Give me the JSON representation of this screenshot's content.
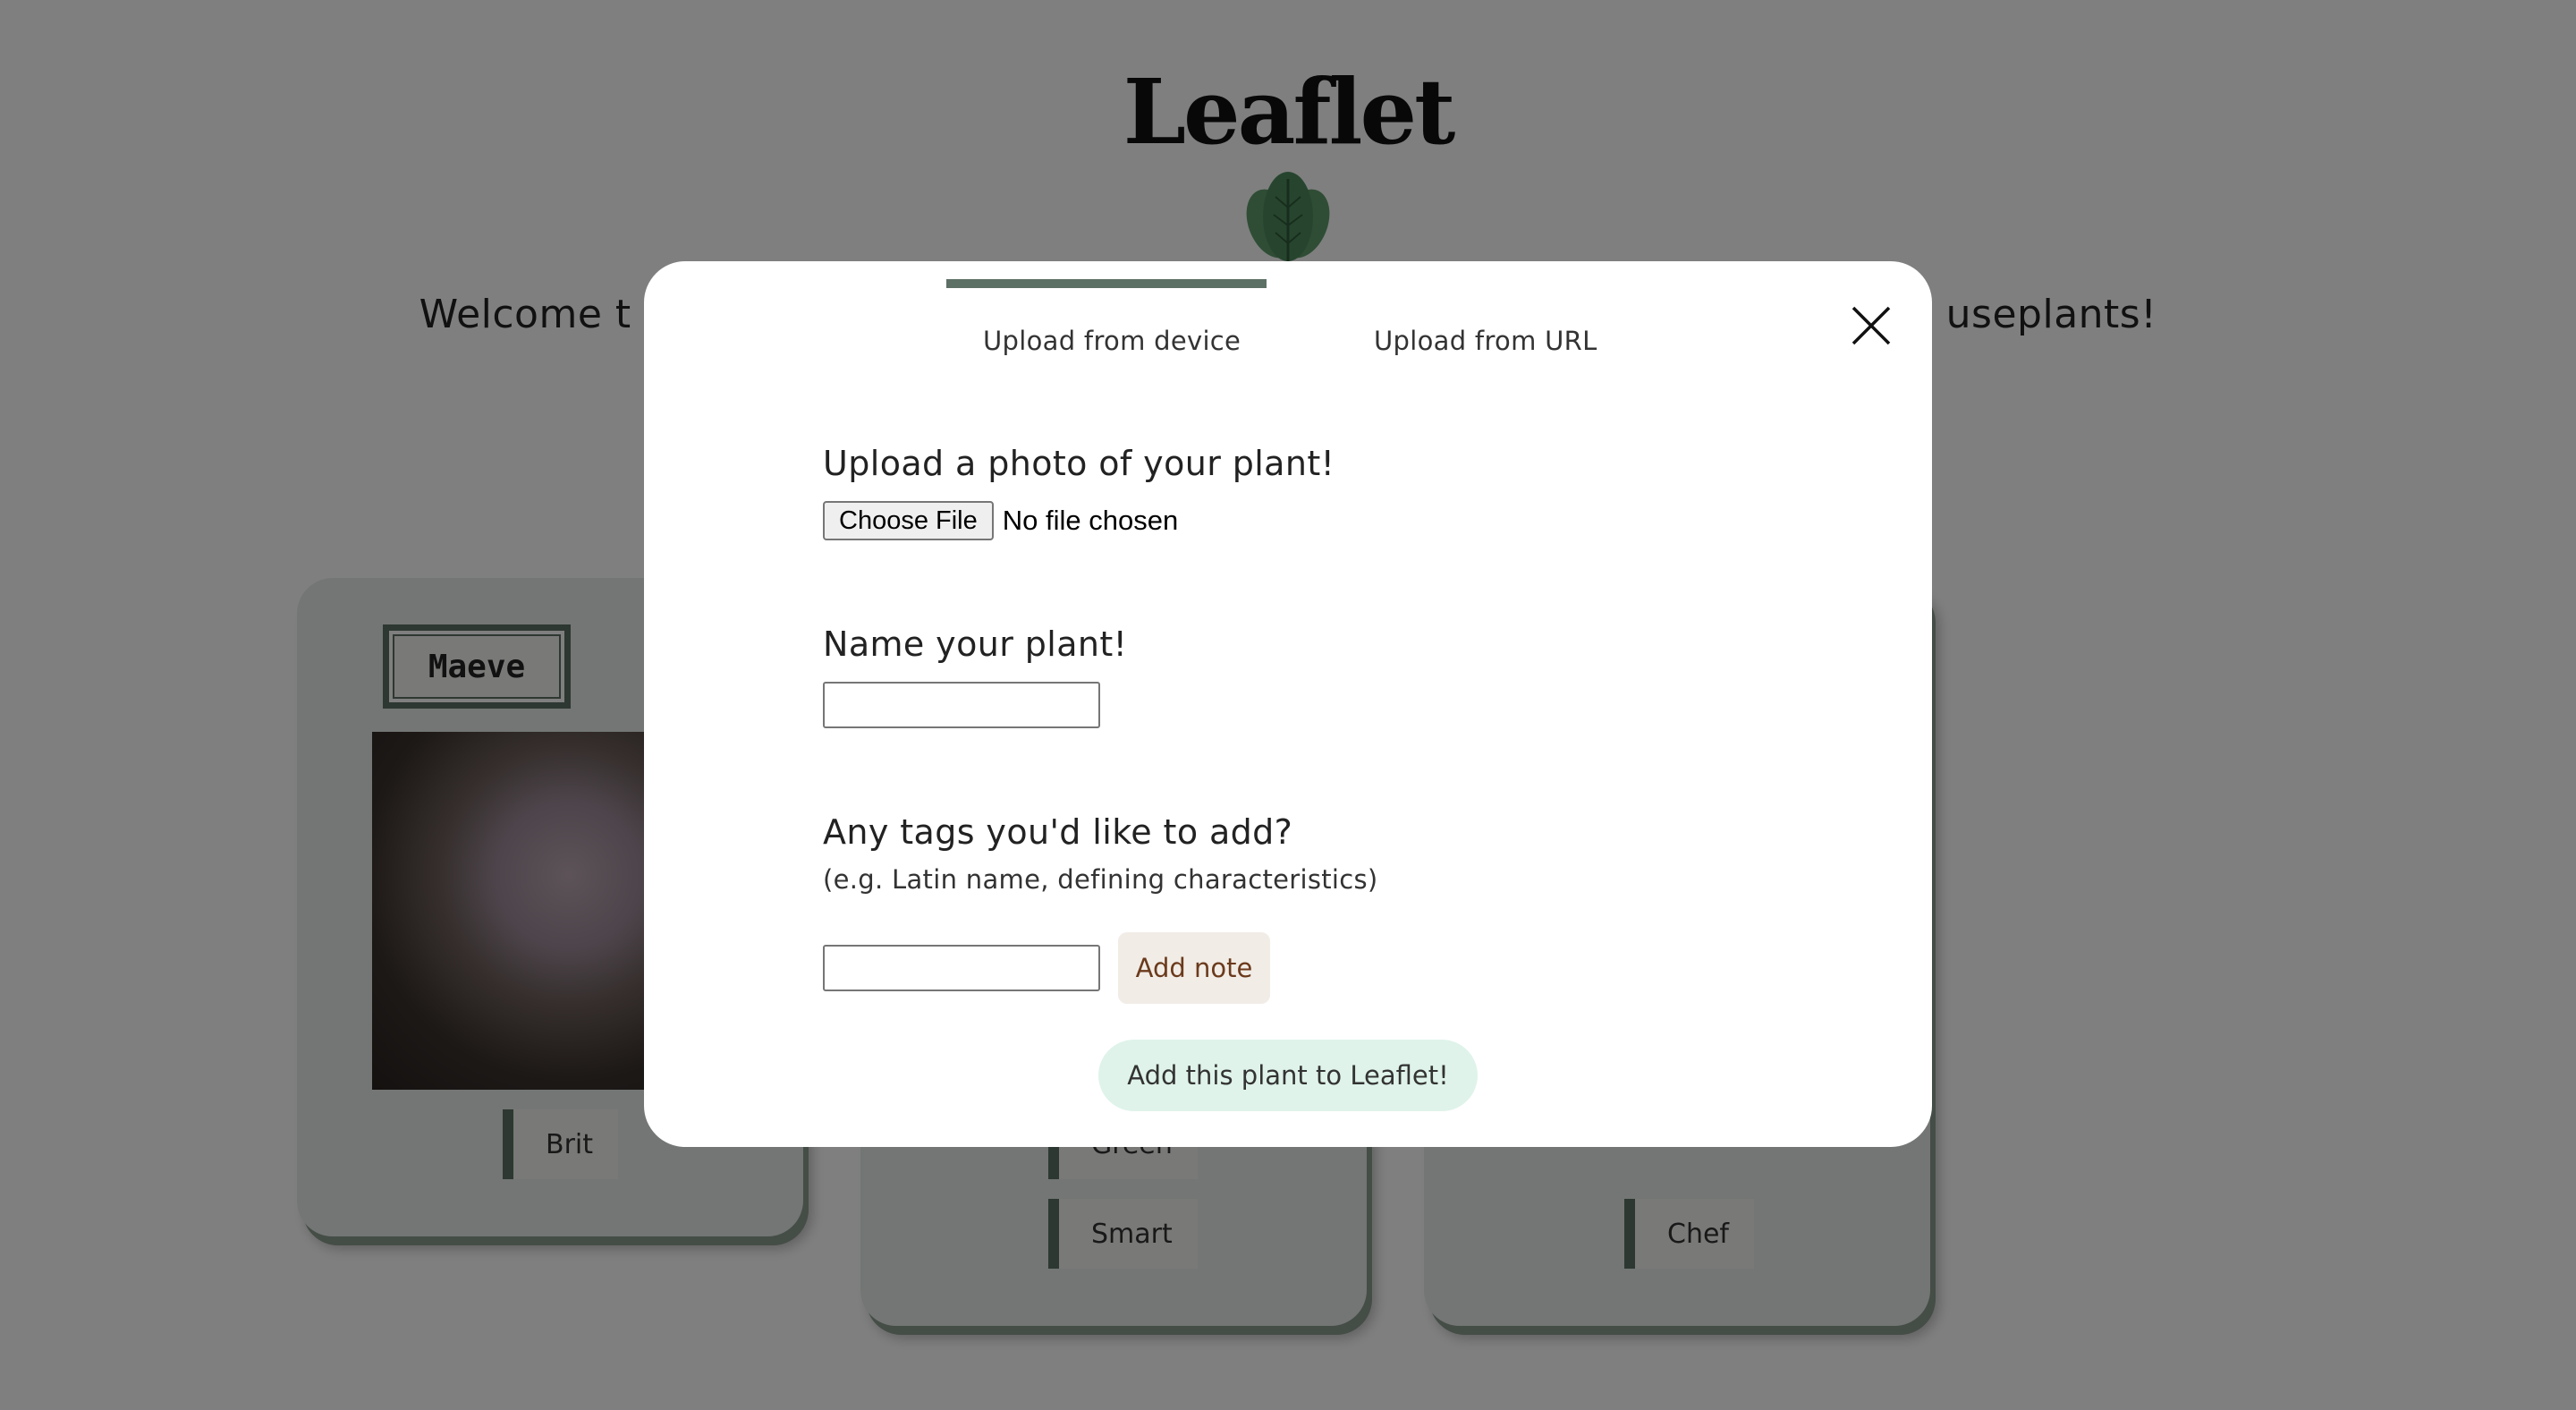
{
  "page": {
    "brand": "Leaflet",
    "welcome_left": "Welcome t",
    "welcome_right": "useplants!"
  },
  "cards": [
    {
      "name": "Maeve",
      "tags": [
        "Brit"
      ]
    },
    {
      "tags": [
        "Green",
        "Smart"
      ]
    },
    {
      "tags": [
        "Chef"
      ]
    }
  ],
  "modal": {
    "tabs": [
      {
        "label": "Upload from device",
        "active": true
      },
      {
        "label": "Upload from URL",
        "active": false
      }
    ],
    "photo_label": "Upload a photo of your plant!",
    "choose_file_label": "Choose File",
    "file_status": "No file chosen",
    "name_label": "Name your plant!",
    "name_value": "",
    "tags_label": "Any tags you'd like to add?",
    "tags_hint": "(e.g. Latin name, defining characteristics)",
    "tag_value": "",
    "add_note_label": "Add note",
    "submit_label": "Add this plant to Leaflet!"
  },
  "colors": {
    "accent": "#5d7065",
    "submit_bg": "#dff3ea",
    "note_bg": "#f1ece6",
    "note_text": "#6b3a1c",
    "overlay": "rgba(0,0,0,0.5)"
  },
  "icons": {
    "brand_leaf": "leaf-icon",
    "close": "close-icon"
  }
}
